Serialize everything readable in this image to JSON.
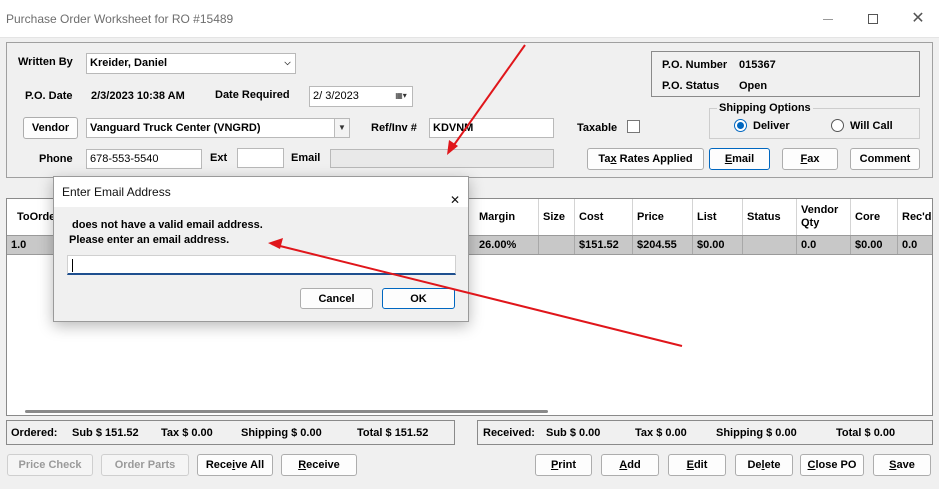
{
  "window": {
    "title": "Purchase Order Worksheet for RO #15489"
  },
  "header": {
    "written_by_label": "Written By",
    "written_by_value": "Kreider, Daniel",
    "po_date_label": "P.O. Date",
    "po_date_value": "2/3/2023 10:38 AM",
    "date_required_label": "Date Required",
    "date_required_value": "2/  3/2023",
    "vendor_button": "Vendor",
    "vendor_value": "Vanguard Truck Center (VNGRD)",
    "refinv_label": "Ref/Inv #",
    "refinv_value": "KDVNM",
    "taxable_label": "Taxable",
    "taxable_checked": false,
    "phone_label": "Phone",
    "phone_value": "678-553-5540",
    "ext_label": "Ext",
    "ext_value": "",
    "email_label": "Email",
    "email_value": "",
    "po_number_label": "P.O. Number",
    "po_number_value": "015367",
    "po_status_label": "P.O. Status",
    "po_status_value": "Open",
    "shipping_options_label": "Shipping Options",
    "shipping_deliver_label": "Deliver",
    "shipping_willcall_label": "Will Call",
    "shipping_selected": "Deliver",
    "tax_rates_button_pre": "Ta",
    "tax_rates_button_key": "x",
    "tax_rates_button_post": " Rates Applied",
    "email_button_key": "E",
    "email_button_rest": "mail",
    "fax_button_key": "F",
    "fax_button_rest": "ax",
    "comment_button": "Comment"
  },
  "grid": {
    "columns": [
      "ToOrder",
      "Margin",
      "Size",
      "Cost",
      "Price",
      "List",
      "Status",
      "Vendor Qty",
      "Core",
      "Rec'd"
    ],
    "column_visible_text": {
      "toorder": "ToOrde",
      "margin": "Margin",
      "size": "Size",
      "cost": "Cost",
      "price": "Price",
      "list": "List",
      "status": "Status",
      "vendor_qty_1": "Vendor",
      "vendor_qty_2": "Qty",
      "core": "Core",
      "recd": "Rec'd"
    },
    "row": {
      "toorder": "1.0",
      "margin": "26.00%",
      "size": "",
      "cost": "$151.52",
      "price": "$204.55",
      "list": "$0.00",
      "status": "",
      "vendor_qty": "0.0",
      "core": "$0.00",
      "recd": "0.0"
    }
  },
  "totals": {
    "ordered_label": "Ordered:",
    "ordered_sub": "Sub  $ 151.52",
    "ordered_tax": "Tax  $ 0.00",
    "ordered_shipping": "Shipping  $ 0.00",
    "ordered_total": "Total  $ 151.52",
    "received_label": "Received:",
    "received_sub": "Sub  $ 0.00",
    "received_tax": "Tax  $ 0.00",
    "received_shipping": "Shipping  $ 0.00",
    "received_total": "Total  $ 0.00"
  },
  "bottom_buttons": {
    "price_check": "Price Check",
    "order_parts": "Order Parts",
    "receive_all_pre": "Rece",
    "receive_all_key": "i",
    "receive_all_post": "ve All",
    "receive_key": "R",
    "receive_rest": "eceive",
    "print_key": "P",
    "print_rest": "rint",
    "add_key": "A",
    "add_rest": "dd",
    "edit_key": "E",
    "edit_rest": "dit",
    "delete_pre": "De",
    "delete_key": "l",
    "delete_post": "ete",
    "close_pre": "",
    "close_key": "C",
    "close_post": "lose PO",
    "save_key": "S",
    "save_rest": "ave"
  },
  "dialog": {
    "title": "Enter Email Address",
    "message_line1": "does not have a valid email address.",
    "message_line2": "Please enter an email address.",
    "input_value": "",
    "cancel": "Cancel",
    "ok": "OK"
  },
  "colors": {
    "accent": "#0067c0",
    "annotation_arrow": "#e0161b",
    "selected_row": "#c8c8c8"
  }
}
